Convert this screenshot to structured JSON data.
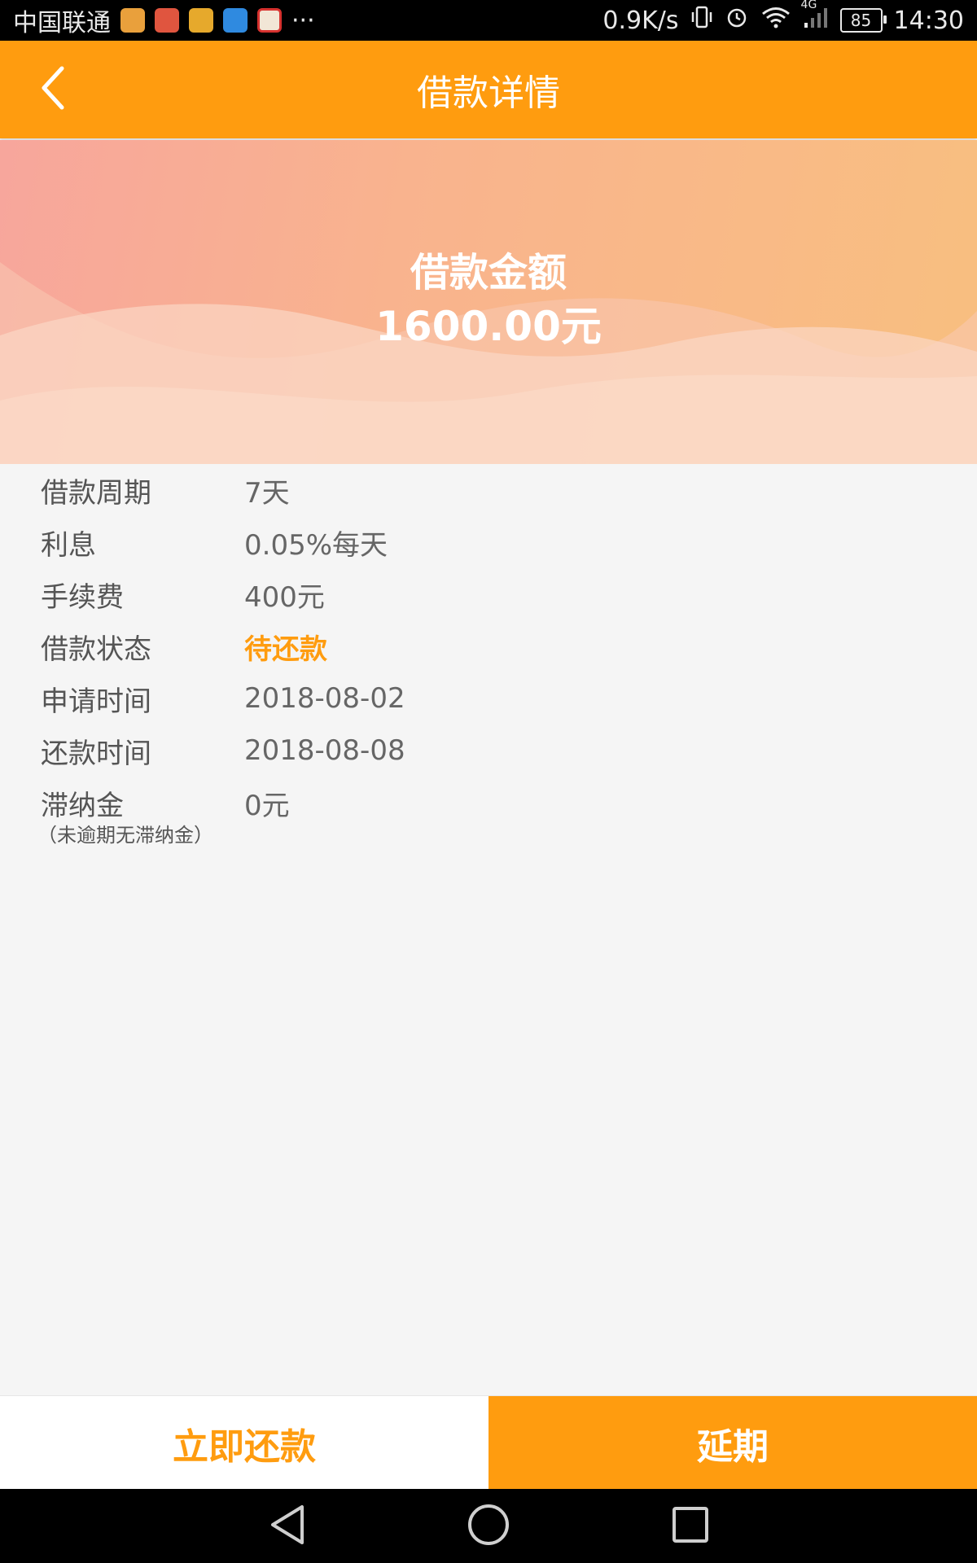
{
  "status_bar": {
    "carrier": "中国联通",
    "more": "···",
    "net_speed": "0.9K/s",
    "network": "4G",
    "battery": "85",
    "time": "14:30",
    "app_icons": [
      {
        "name": "notification-app-1-icon",
        "color": "#e9a03c"
      },
      {
        "name": "notification-app-2-icon",
        "color": "#e0553f"
      },
      {
        "name": "notification-app-3-icon",
        "color": "#e6a92c"
      },
      {
        "name": "notification-app-4-icon",
        "color": "#2f8ae0"
      },
      {
        "name": "notification-app-5-icon",
        "color": "#d7322f"
      }
    ]
  },
  "appbar": {
    "title": "借款详情",
    "back_icon": "chevron-left-icon"
  },
  "banner": {
    "label": "借款金额",
    "amount": "1600.00元"
  },
  "details": [
    {
      "label": "借款周期",
      "value": "7天"
    },
    {
      "label": "利息",
      "value": "0.05%每天"
    },
    {
      "label": "手续费",
      "value": "400元"
    },
    {
      "label": "借款状态",
      "value": "待还款"
    },
    {
      "label": "申请时间",
      "value": "2018-08-02"
    },
    {
      "label": "还款时间",
      "value": "2018-08-08"
    },
    {
      "label": "滞纳金",
      "value": "0元",
      "note": "（未逾期无滞纳金）"
    }
  ],
  "actions": {
    "repay": "立即还款",
    "extend": "延期"
  },
  "colors": {
    "accent": "#ff9c0f",
    "status_pending": "#ff9c0f"
  }
}
